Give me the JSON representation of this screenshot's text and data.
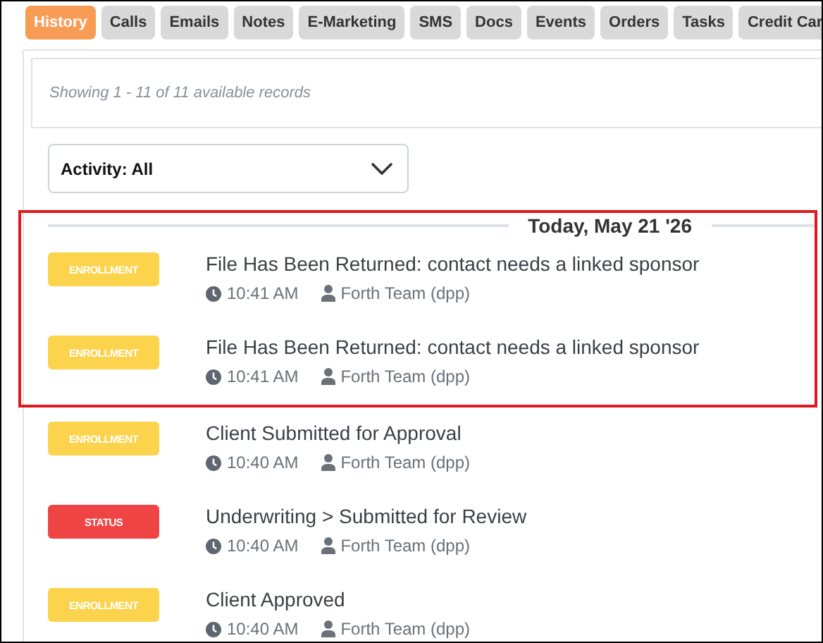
{
  "tabs": [
    {
      "label": "History",
      "selected": true
    },
    {
      "label": "Calls",
      "selected": false
    },
    {
      "label": "Emails",
      "selected": false
    },
    {
      "label": "Notes",
      "selected": false
    },
    {
      "label": "E-Marketing",
      "selected": false
    },
    {
      "label": "SMS",
      "selected": false
    },
    {
      "label": "Docs",
      "selected": false
    },
    {
      "label": "Events",
      "selected": false
    },
    {
      "label": "Orders",
      "selected": false
    },
    {
      "label": "Tasks",
      "selected": false
    },
    {
      "label": "Credit Car",
      "selected": false
    }
  ],
  "summary": "Showing 1 - 11 of 11 available records",
  "filter": {
    "value": "Activity: All"
  },
  "date_header": "Today, May 21 '26",
  "entries": [
    {
      "badge": "ENROLLMENT",
      "color": "#fcd34d",
      "title": "File Has Been Returned: contact needs a linked sponsor",
      "time": "10:41 AM",
      "user": "Forth Team (dpp)",
      "highlighted": true
    },
    {
      "badge": "ENROLLMENT",
      "color": "#fcd34d",
      "title": "File Has Been Returned: contact needs a linked sponsor",
      "time": "10:41 AM",
      "user": "Forth Team (dpp)",
      "highlighted": true
    },
    {
      "badge": "ENROLLMENT",
      "color": "#fcd34d",
      "title": "Client Submitted for Approval",
      "time": "10:40 AM",
      "user": "Forth Team (dpp)",
      "highlighted": false
    },
    {
      "badge": "STATUS",
      "color": "#ef4444",
      "title": "Underwriting > Submitted for Review",
      "time": "10:40 AM",
      "user": "Forth Team (dpp)",
      "highlighted": false
    },
    {
      "badge": "ENROLLMENT",
      "color": "#fcd34d",
      "title": "Client Approved",
      "time": "10:40 AM",
      "user": "Forth Team (dpp)",
      "highlighted": false
    }
  ]
}
